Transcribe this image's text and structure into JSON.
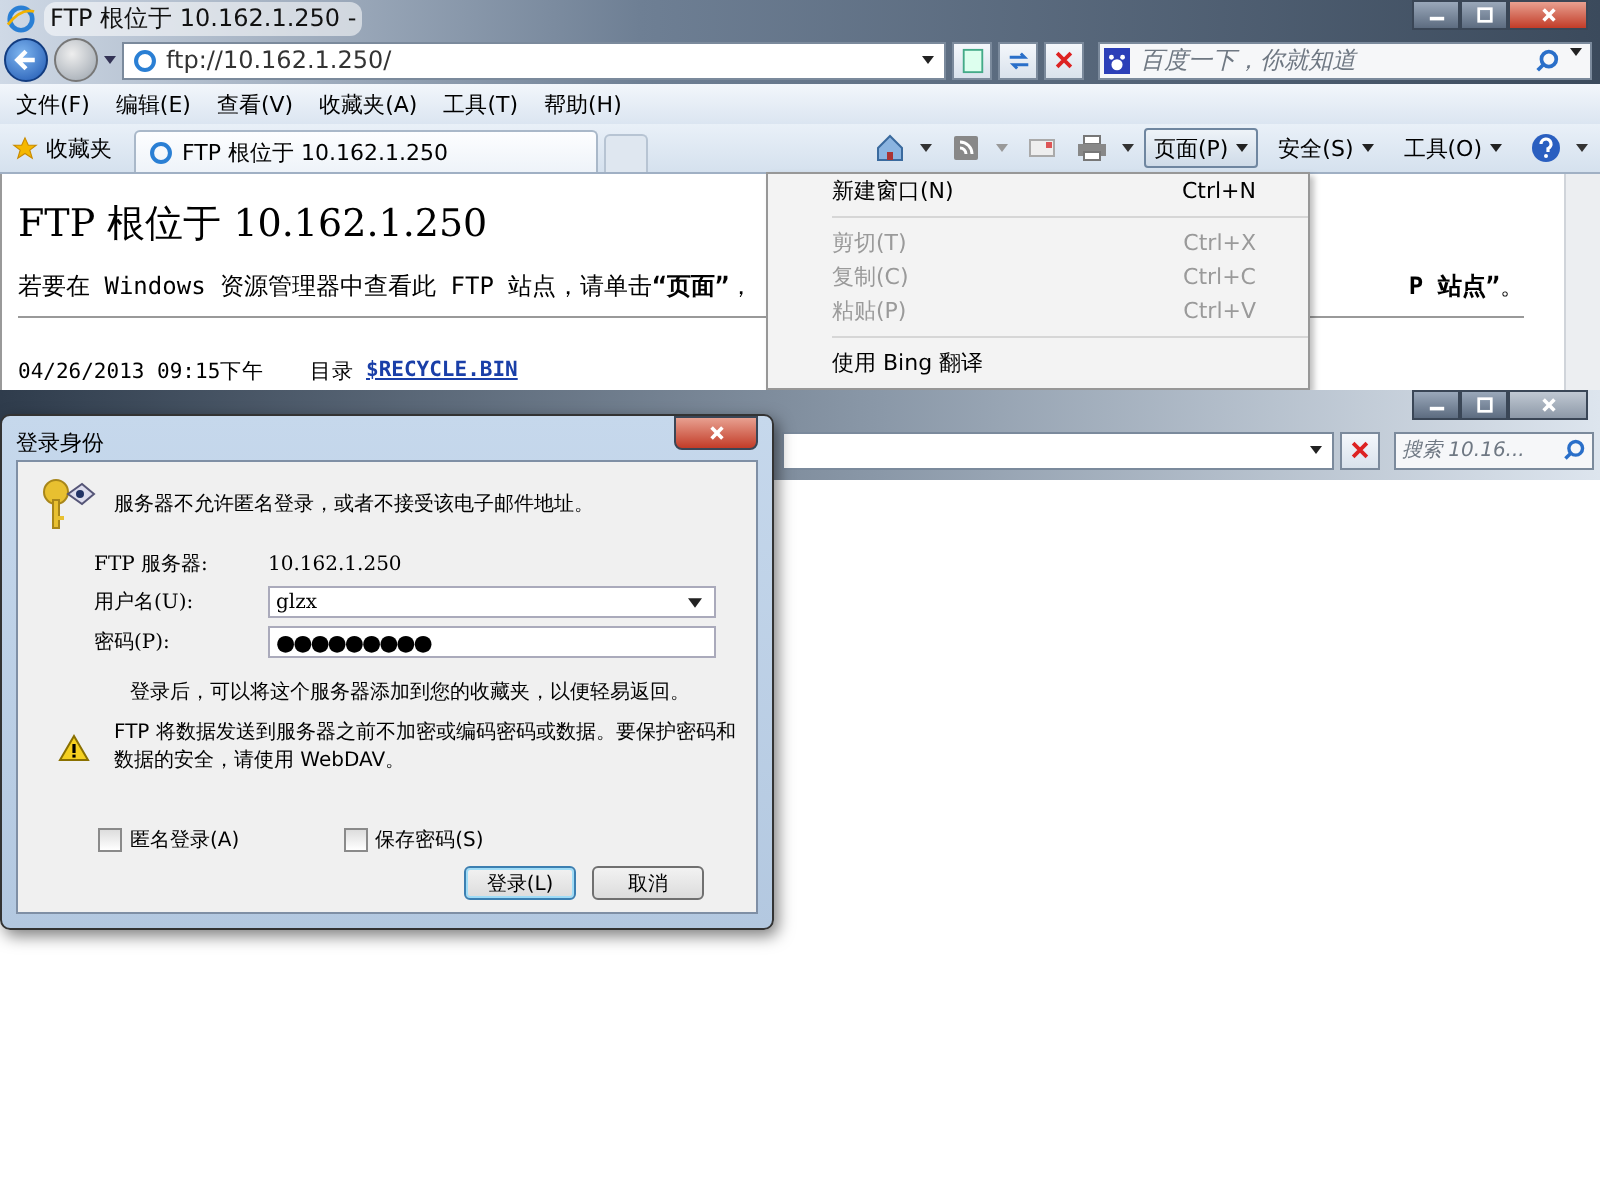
{
  "browser": {
    "title": "FTP 根位于 10.162.1.250 -",
    "address": "ftp://10.162.1.250/",
    "search_placeholder": "百度一下，你就知道",
    "menu_bar": [
      "文件(F)",
      "编辑(E)",
      "查看(V)",
      "收藏夹(A)",
      "工具(T)",
      "帮助(H)"
    ],
    "favorites": "收藏夹",
    "tabs": [
      {
        "label": "FTP 根位于 10.162.1.250",
        "selected": true
      }
    ],
    "command_buttons": [
      {
        "label": "页面(P)",
        "selected": true
      },
      {
        "label": "安全(S)",
        "selected": false
      },
      {
        "label": "工具(O)",
        "selected": false
      }
    ],
    "page": {
      "heading": "FTP 根位于 10.162.1.250",
      "intro_left": "若要在 Windows 资源管理器中查看此 FTP 站点，请单击**“页面”**，",
      "intro_right": "**P 站点”**。",
      "listing": [
        {
          "date": "04/26/2013 09:15下午",
          "type": "目录",
          "name": "$RECYCLE.BIN"
        }
      ]
    }
  },
  "page_menu": {
    "items": [
      {
        "kind": "item",
        "label": "新建窗口(N)",
        "shortcut": "Ctrl+N",
        "disabled": false
      },
      {
        "kind": "separator"
      },
      {
        "kind": "item",
        "label": "剪切(T)",
        "shortcut": "Ctrl+X",
        "disabled": true
      },
      {
        "kind": "item",
        "label": "复制(C)",
        "shortcut": "Ctrl+C",
        "disabled": true
      },
      {
        "kind": "item",
        "label": "粘贴(P)",
        "shortcut": "Ctrl+V",
        "disabled": true
      },
      {
        "kind": "separator"
      },
      {
        "kind": "item",
        "label": "使用 Bing 翻译",
        "disabled": false
      }
    ]
  },
  "second_window": {
    "search_placeholder": "搜索 10.16..."
  },
  "login_dialog": {
    "title": "登录身份",
    "message": "服务器不允许匿名登录，或者不接受该电子邮件地址。",
    "server_label": "FTP 服务器:",
    "server": "10.162.1.250",
    "username_label": "用户名(U):",
    "username": "glzx",
    "password_label": "密码(P):",
    "password": "●●●●●●●●●",
    "info": "登录后，可以将这个服务器添加到您的收藏夹，以便轻易返回。",
    "warning": "FTP 将数据发送到服务器之前不加密或编码密码或数据。要保护密码和数据的安全，请使用 WebDAV。",
    "checkboxes": [
      {
        "label": "匿名登录(A)",
        "checked": false
      },
      {
        "label": "保存密码(S)",
        "checked": false
      }
    ],
    "buttons": [
      {
        "label": "登录(L)",
        "default": true
      },
      {
        "label": "取消",
        "default": false
      }
    ]
  }
}
